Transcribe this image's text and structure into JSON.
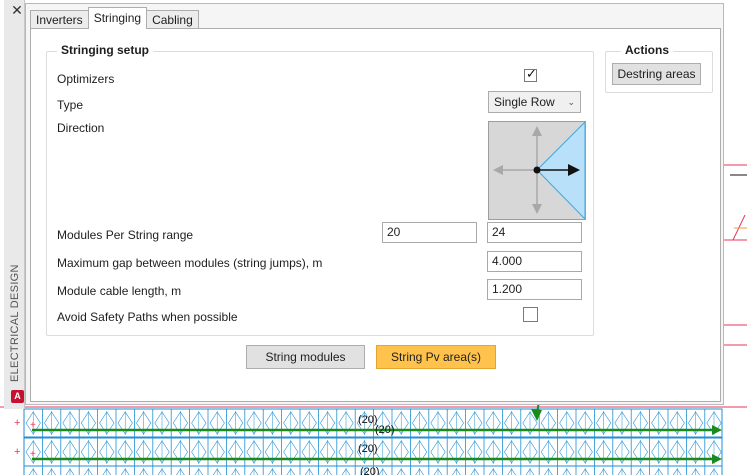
{
  "side_bar": {
    "title": "ELECTRICAL DESIGN",
    "close_glyph": "✕",
    "logo_text": "A"
  },
  "tabs": [
    {
      "label": "Inverters",
      "active": false
    },
    {
      "label": "Stringing",
      "active": true
    },
    {
      "label": "Cabling",
      "active": false
    }
  ],
  "stringing_setup": {
    "title": "Stringing setup",
    "optimizers": {
      "label": "Optimizers",
      "checked": true
    },
    "type": {
      "label": "Type",
      "value": "Single Row"
    },
    "direction": {
      "label": "Direction",
      "selected": "right"
    },
    "modules_per_string": {
      "label": "Modules Per String range",
      "min": "20",
      "max": "24"
    },
    "max_gap": {
      "label": "Maximum gap between modules (string jumps), m",
      "value": "4.000"
    },
    "cable_length": {
      "label": "Module cable length, m",
      "value": "1.200"
    },
    "avoid_safety": {
      "label": "Avoid Safety Paths when possible",
      "checked": false
    }
  },
  "actions": {
    "title": "Actions",
    "destring_label": "Destring areas"
  },
  "buttons": {
    "string_modules": "String modules",
    "string_pv": "String Pv area(s)"
  },
  "cad": {
    "string_labels": [
      "(20)",
      "(20)",
      "(20)",
      "(20)"
    ],
    "colors": {
      "grid": "#1f8fd6",
      "string": "#1a8a1a",
      "boundary": "#e8365a"
    }
  }
}
